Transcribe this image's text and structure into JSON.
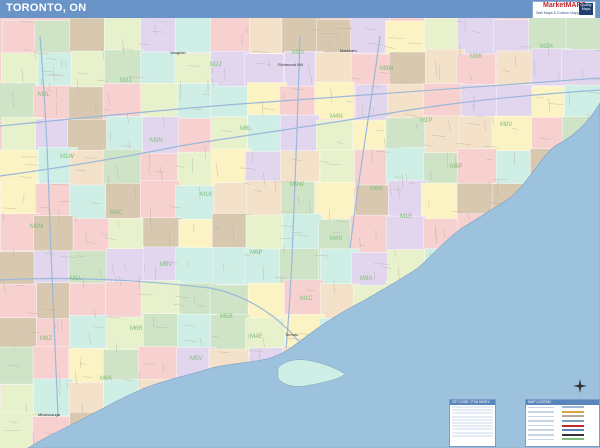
{
  "header": {
    "title": "TORONTO, ON",
    "logo_brand": "MarketMAPS",
    "logo_tagline": "Wall Maps & Custom Mapping",
    "logo_badge": "Quality Maps"
  },
  "map": {
    "water_color": "#9cc2dd",
    "land_colors": [
      "#f6d1cf",
      "#cfe3c7",
      "#fbf3c4",
      "#e2d6ef",
      "#d8c8b0",
      "#cfeee6",
      "#f4e1c9",
      "#e7f2cc"
    ],
    "shoreline_color": "#7e9fbf",
    "highway_color": "#9bb8da",
    "local_street_color": "#b3a89a"
  },
  "places": {
    "upper_north": "Vaughan",
    "upper_mid": "Richmond Hill",
    "upper_east": "Markham",
    "downtown": "Toronto",
    "southwest": "Mississauga"
  },
  "fsa_labels": [
    "M9L",
    "M3J",
    "M2J",
    "M1V",
    "M9M",
    "M3K",
    "M2H",
    "M1W",
    "M9N",
    "M6L",
    "M4N",
    "M1P",
    "M8V",
    "M6M",
    "M4C",
    "M1K",
    "M9W",
    "M6N",
    "M5P",
    "M1L",
    "M9V",
    "M6P",
    "M4S",
    "M1E",
    "M8Z",
    "M6R",
    "M5R",
    "M1C",
    "M9A",
    "M6K",
    "M5V",
    "M4E"
  ],
  "legend": {
    "left_title": "ZIP CODE / FSA INDEX",
    "right_title": "MAP LEGEND"
  }
}
